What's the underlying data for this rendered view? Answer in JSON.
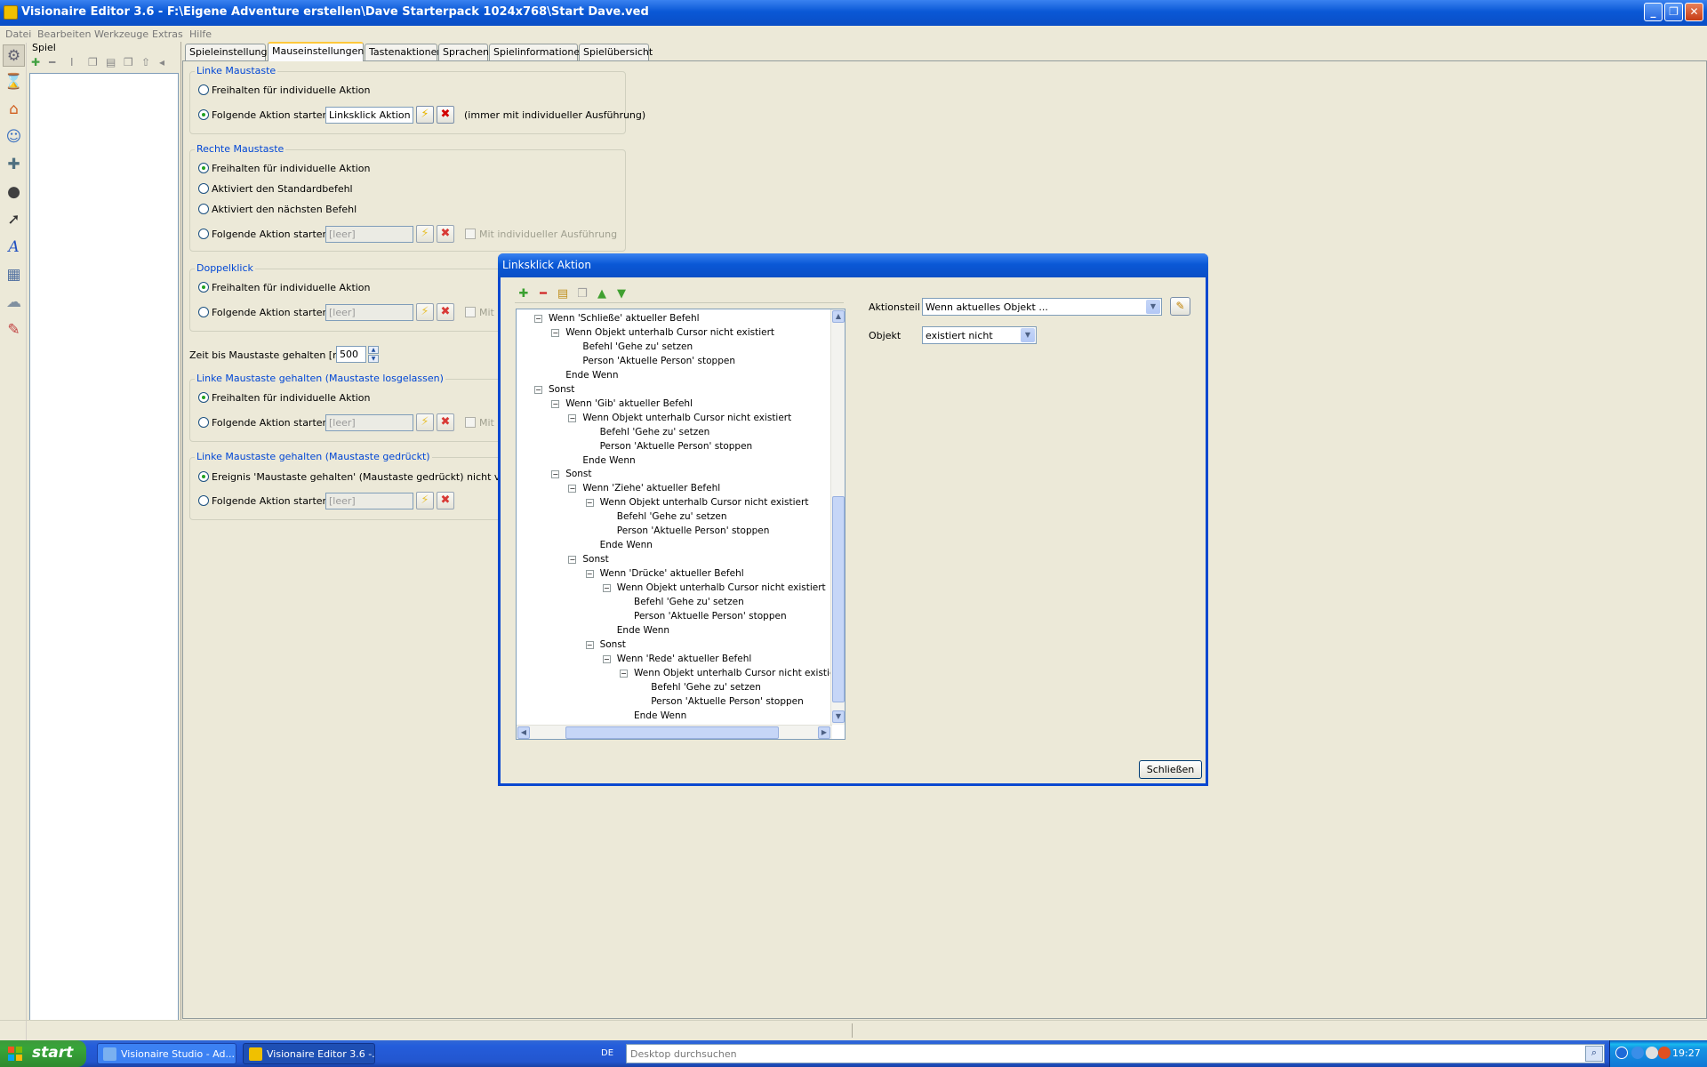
{
  "window": {
    "title": "Visionaire Editor 3.6 - F:\\Eigene Adventure erstellen\\Dave Starterpack 1024x768\\Start Dave.ved",
    "min": "_",
    "max": "❐",
    "close": "✕"
  },
  "menu": [
    "Datei",
    "Bearbeiten",
    "Werkzeuge",
    "Extras",
    "Hilfe"
  ],
  "left_panel": {
    "title": "Spiel"
  },
  "tabs": [
    "Spieleinstellungen",
    "Mauseinstellungen",
    "Tastenaktionen",
    "Sprachen",
    "Spielinformationen",
    "Spielübersicht"
  ],
  "active_tab": "Mauseinstellungen",
  "groups": {
    "left": {
      "title": "Linke Maustaste",
      "opt1": "Freihalten für individuelle Aktion",
      "opt2": "Folgende Aktion starten",
      "action": "Linksklick Aktion",
      "note": "(immer mit individueller Ausführung)"
    },
    "right": {
      "title": "Rechte Maustaste",
      "opt1": "Freihalten für individuelle Aktion",
      "opt2": "Aktiviert den Standardbefehl",
      "opt3": "Aktiviert den nächsten Befehl",
      "opt4": "Folgende Aktion starten",
      "action": "[leer]",
      "check": "Mit individueller Ausführung"
    },
    "double": {
      "title": "Doppelklick",
      "opt1": "Freihalten für individuelle Aktion",
      "opt2": "Folgende Aktion starten",
      "action": "[leer]",
      "check": "Mit in"
    },
    "hold_time": {
      "label": "Zeit bis Maustaste gehalten [ms]",
      "value": "500"
    },
    "hold_release": {
      "title": "Linke Maustaste gehalten (Maustaste losgelassen)",
      "opt1": "Freihalten für individuelle Aktion",
      "opt2": "Folgende Aktion starten",
      "action": "[leer]",
      "check": "Mit in"
    },
    "hold_press": {
      "title": "Linke Maustaste gehalten (Maustaste gedrückt)",
      "opt1": "Ereignis 'Maustaste gehalten' (Maustaste gedrückt) nicht verwende",
      "opt2": "Folgende Aktion starten",
      "action": "[leer]"
    }
  },
  "dialog": {
    "title": "Linksklick Aktion",
    "tree": [
      {
        "level": 0,
        "exp": true,
        "text": "Wenn 'Schließe' aktueller Befehl"
      },
      {
        "level": 1,
        "exp": true,
        "text": "Wenn Objekt unterhalb Cursor nicht existiert"
      },
      {
        "level": 2,
        "exp": false,
        "text": "Befehl 'Gehe zu' setzen"
      },
      {
        "level": 2,
        "exp": false,
        "text": "Person 'Aktuelle Person' stoppen"
      },
      {
        "level": 1,
        "exp": false,
        "text": "Ende Wenn"
      },
      {
        "level": 0,
        "exp": true,
        "text": "Sonst"
      },
      {
        "level": 1,
        "exp": true,
        "text": "Wenn 'Gib' aktueller Befehl"
      },
      {
        "level": 2,
        "exp": true,
        "text": "Wenn Objekt unterhalb Cursor nicht existiert"
      },
      {
        "level": 3,
        "exp": false,
        "text": "Befehl 'Gehe zu' setzen"
      },
      {
        "level": 3,
        "exp": false,
        "text": "Person 'Aktuelle Person' stoppen"
      },
      {
        "level": 2,
        "exp": false,
        "text": "Ende Wenn"
      },
      {
        "level": 1,
        "exp": true,
        "text": "Sonst"
      },
      {
        "level": 2,
        "exp": true,
        "text": "Wenn 'Ziehe' aktueller Befehl"
      },
      {
        "level": 3,
        "exp": true,
        "text": "Wenn Objekt unterhalb Cursor nicht existiert"
      },
      {
        "level": 4,
        "exp": false,
        "text": "Befehl 'Gehe zu' setzen"
      },
      {
        "level": 4,
        "exp": false,
        "text": "Person 'Aktuelle Person' stoppen"
      },
      {
        "level": 3,
        "exp": false,
        "text": "Ende Wenn"
      },
      {
        "level": 2,
        "exp": true,
        "text": "Sonst"
      },
      {
        "level": 3,
        "exp": true,
        "text": "Wenn 'Drücke' aktueller Befehl"
      },
      {
        "level": 4,
        "exp": true,
        "text": "Wenn Objekt unterhalb Cursor nicht existiert"
      },
      {
        "level": 5,
        "exp": false,
        "text": "Befehl 'Gehe zu' setzen"
      },
      {
        "level": 5,
        "exp": false,
        "text": "Person 'Aktuelle Person' stoppen"
      },
      {
        "level": 4,
        "exp": false,
        "text": "Ende Wenn"
      },
      {
        "level": 3,
        "exp": true,
        "text": "Sonst"
      },
      {
        "level": 4,
        "exp": true,
        "text": "Wenn 'Rede' aktueller Befehl"
      },
      {
        "level": 5,
        "exp": true,
        "text": "Wenn Objekt unterhalb Cursor nicht existiert"
      },
      {
        "level": 6,
        "exp": false,
        "text": "Befehl 'Gehe zu' setzen"
      },
      {
        "level": 6,
        "exp": false,
        "text": "Person 'Aktuelle Person' stoppen"
      },
      {
        "level": 5,
        "exp": false,
        "text": "Ende Wenn"
      }
    ],
    "aktionsteil_label": "Aktionsteil",
    "aktionsteil_value": "Wenn aktuelles Objekt ...",
    "objekt_label": "Objekt",
    "objekt_value": "existiert nicht",
    "close_button": "Schließen"
  },
  "taskbar": {
    "start": "start",
    "items": [
      "Visionaire Studio - Ad...",
      "Visionaire Editor 3.6 -..."
    ],
    "lang": "DE",
    "search_placeholder": "Desktop durchsuchen",
    "clock": "19:27"
  }
}
